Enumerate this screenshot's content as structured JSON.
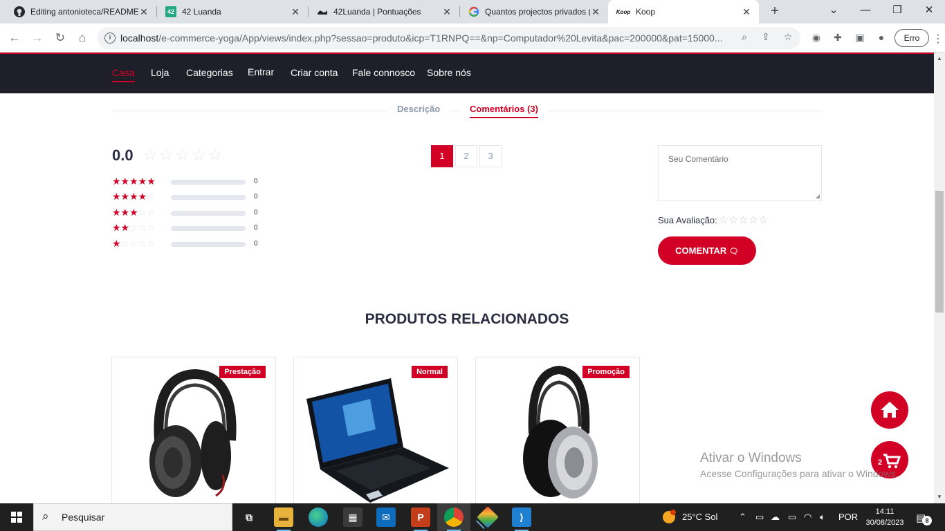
{
  "browser": {
    "tabs": [
      {
        "title": "Editing antonioteca/README.md",
        "icon": "github-icon"
      },
      {
        "title": "42 Luanda",
        "icon": "42-icon"
      },
      {
        "title": "42Luanda | Pontuações",
        "icon": "42luanda-icon"
      },
      {
        "title": "Quantos projectos privados (",
        "icon": "google-icon"
      },
      {
        "title": "Koop",
        "icon": "koop-icon"
      }
    ],
    "url_host": "localhost",
    "url_path": "/e-commerce-yoga/App/views/index.php?sessao=produto&icp=T1RNPQ==&np=Computador%20Levita&pac=200000&pat=15000...",
    "profile_button": "Erro"
  },
  "site_nav": {
    "items": [
      "Casa",
      "Loja",
      "Categorias",
      "Entrar",
      "Criar conta",
      "Fale connosco",
      "Sobre nós"
    ],
    "active": "Casa"
  },
  "product_tabs": {
    "description": "Descrição",
    "comments": "Comentários (3)",
    "active": "comments"
  },
  "rating": {
    "average": "0.0",
    "average_stars": 0,
    "breakdown": [
      {
        "stars": 5,
        "count": "0",
        "fraction": 0
      },
      {
        "stars": 4,
        "count": "0",
        "fraction": 0
      },
      {
        "stars": 3,
        "count": "0",
        "fraction": 0
      },
      {
        "stars": 2,
        "count": "0",
        "fraction": 0
      },
      {
        "stars": 1,
        "count": "0",
        "fraction": 0
      }
    ]
  },
  "pagination": {
    "pages": [
      "1",
      "2",
      "3"
    ],
    "current": "1"
  },
  "comment_form": {
    "placeholder": "Seu Comentário",
    "rating_label": "Sua Avaliação:",
    "rating_value": 0,
    "submit_label": "COMENTAR"
  },
  "related": {
    "title": "PRODUTOS RELACIONADOS",
    "products": [
      {
        "badge": "Prestação",
        "image": "headphones-image"
      },
      {
        "badge": "Normal",
        "image": "laptop-image"
      },
      {
        "badge": "Promoção",
        "image": "headphones-silver-image"
      }
    ]
  },
  "floating": {
    "home_icon": "home-icon",
    "cart_icon": "cart-icon",
    "cart_count": "2"
  },
  "watermark": {
    "title": "Ativar o Windows",
    "subtitle": "Acesse Configurações para ativar o Windows."
  },
  "taskbar": {
    "search_placeholder": "Pesquisar",
    "weather": "25°C  Sol",
    "language": "POR",
    "time": "14:11",
    "date": "30/08/2023",
    "notifications": "8"
  },
  "colors": {
    "accent": "#d10024",
    "nav_bg": "#1e1f29",
    "muted": "#8d99ae"
  }
}
